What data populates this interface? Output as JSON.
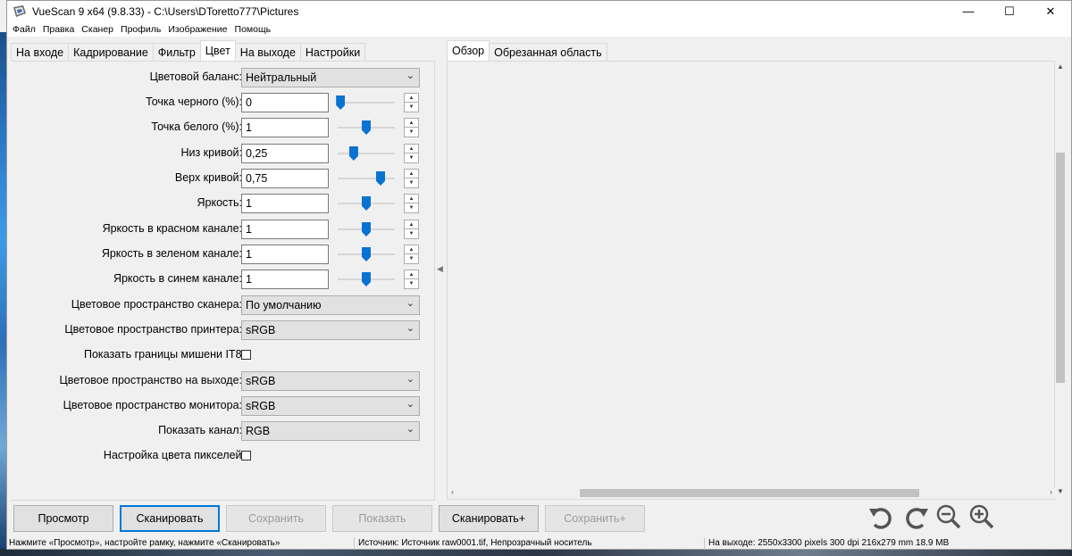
{
  "window": {
    "title": "VueScan 9 x64 (9.8.33) - C:\\Users\\DToretto777\\Pictures",
    "controls": {
      "minimize": "—",
      "maximize": "☐",
      "close": "✕"
    }
  },
  "menu": [
    "Файл",
    "Правка",
    "Сканер",
    "Профиль",
    "Изображение",
    "Помощь"
  ],
  "left_tabs": [
    "На входе",
    "Кадрирование",
    "Фильтр",
    "Цвет",
    "На выходе",
    "Настройки"
  ],
  "left_active_tab": "Цвет",
  "color": {
    "color_balance": {
      "label": "Цветовой баланс:",
      "value": "Нейтральный"
    },
    "black_point": {
      "label": "Точка черного (%):",
      "value": "0",
      "slider": 0.05
    },
    "white_point": {
      "label": "Точка белого (%):",
      "value": "1",
      "slider": 0.5
    },
    "curve_low": {
      "label": "Низ кривой:",
      "value": "0,25",
      "slider": 0.28
    },
    "curve_high": {
      "label": "Верх кривой:",
      "value": "0,75",
      "slider": 0.75
    },
    "brightness": {
      "label": "Яркость:",
      "value": "1",
      "slider": 0.5
    },
    "red_brightness": {
      "label": "Яркость в красном канале:",
      "value": "1",
      "slider": 0.5
    },
    "green_brightness": {
      "label": "Яркость в зеленом канале:",
      "value": "1",
      "slider": 0.5
    },
    "blue_brightness": {
      "label": "Яркость в синем канале:",
      "value": "1",
      "slider": 0.5
    },
    "scanner_space": {
      "label": "Цветовое пространство сканера:",
      "value": "По умолчанию"
    },
    "printer_space": {
      "label": "Цветовое пространство принтера:",
      "value": "sRGB"
    },
    "it8": {
      "label": "Показать границы мишени IT8:",
      "checked": false
    },
    "output_space": {
      "label": "Цветовое пространство на выходе:",
      "value": "sRGB"
    },
    "monitor_space": {
      "label": "Цветовое пространство монитора:",
      "value": "sRGB"
    },
    "show_channel": {
      "label": "Показать канал:",
      "value": "RGB"
    },
    "pixel_color": {
      "label": "Настройка цвета пикселей:",
      "checked": false
    }
  },
  "right_tabs": [
    "Обзор",
    "Обрезанная область"
  ],
  "right_active_tab": "Обзор",
  "buttons": {
    "preview": "Просмотр",
    "scan": "Сканировать",
    "save": "Сохранить",
    "show": "Показать",
    "scan_plus": "Сканировать+",
    "save_plus": "Сохранить+"
  },
  "status": {
    "hint": "Нажмите «Просмотр», настройте рамку, нажмите «Сканировать»",
    "source": "Источник: Источник raw0001.tif, Непрозрачный носитель",
    "output": "На выходе: 2550x3300 pixels 300 dpi 216x279 mm 18.9 MB"
  },
  "icons": [
    "rotate-left-icon",
    "rotate-right-icon",
    "zoom-out-icon",
    "zoom-in-icon"
  ],
  "colors": {
    "accent": "#0078d7",
    "slider_thumb": "#0a73d1"
  }
}
